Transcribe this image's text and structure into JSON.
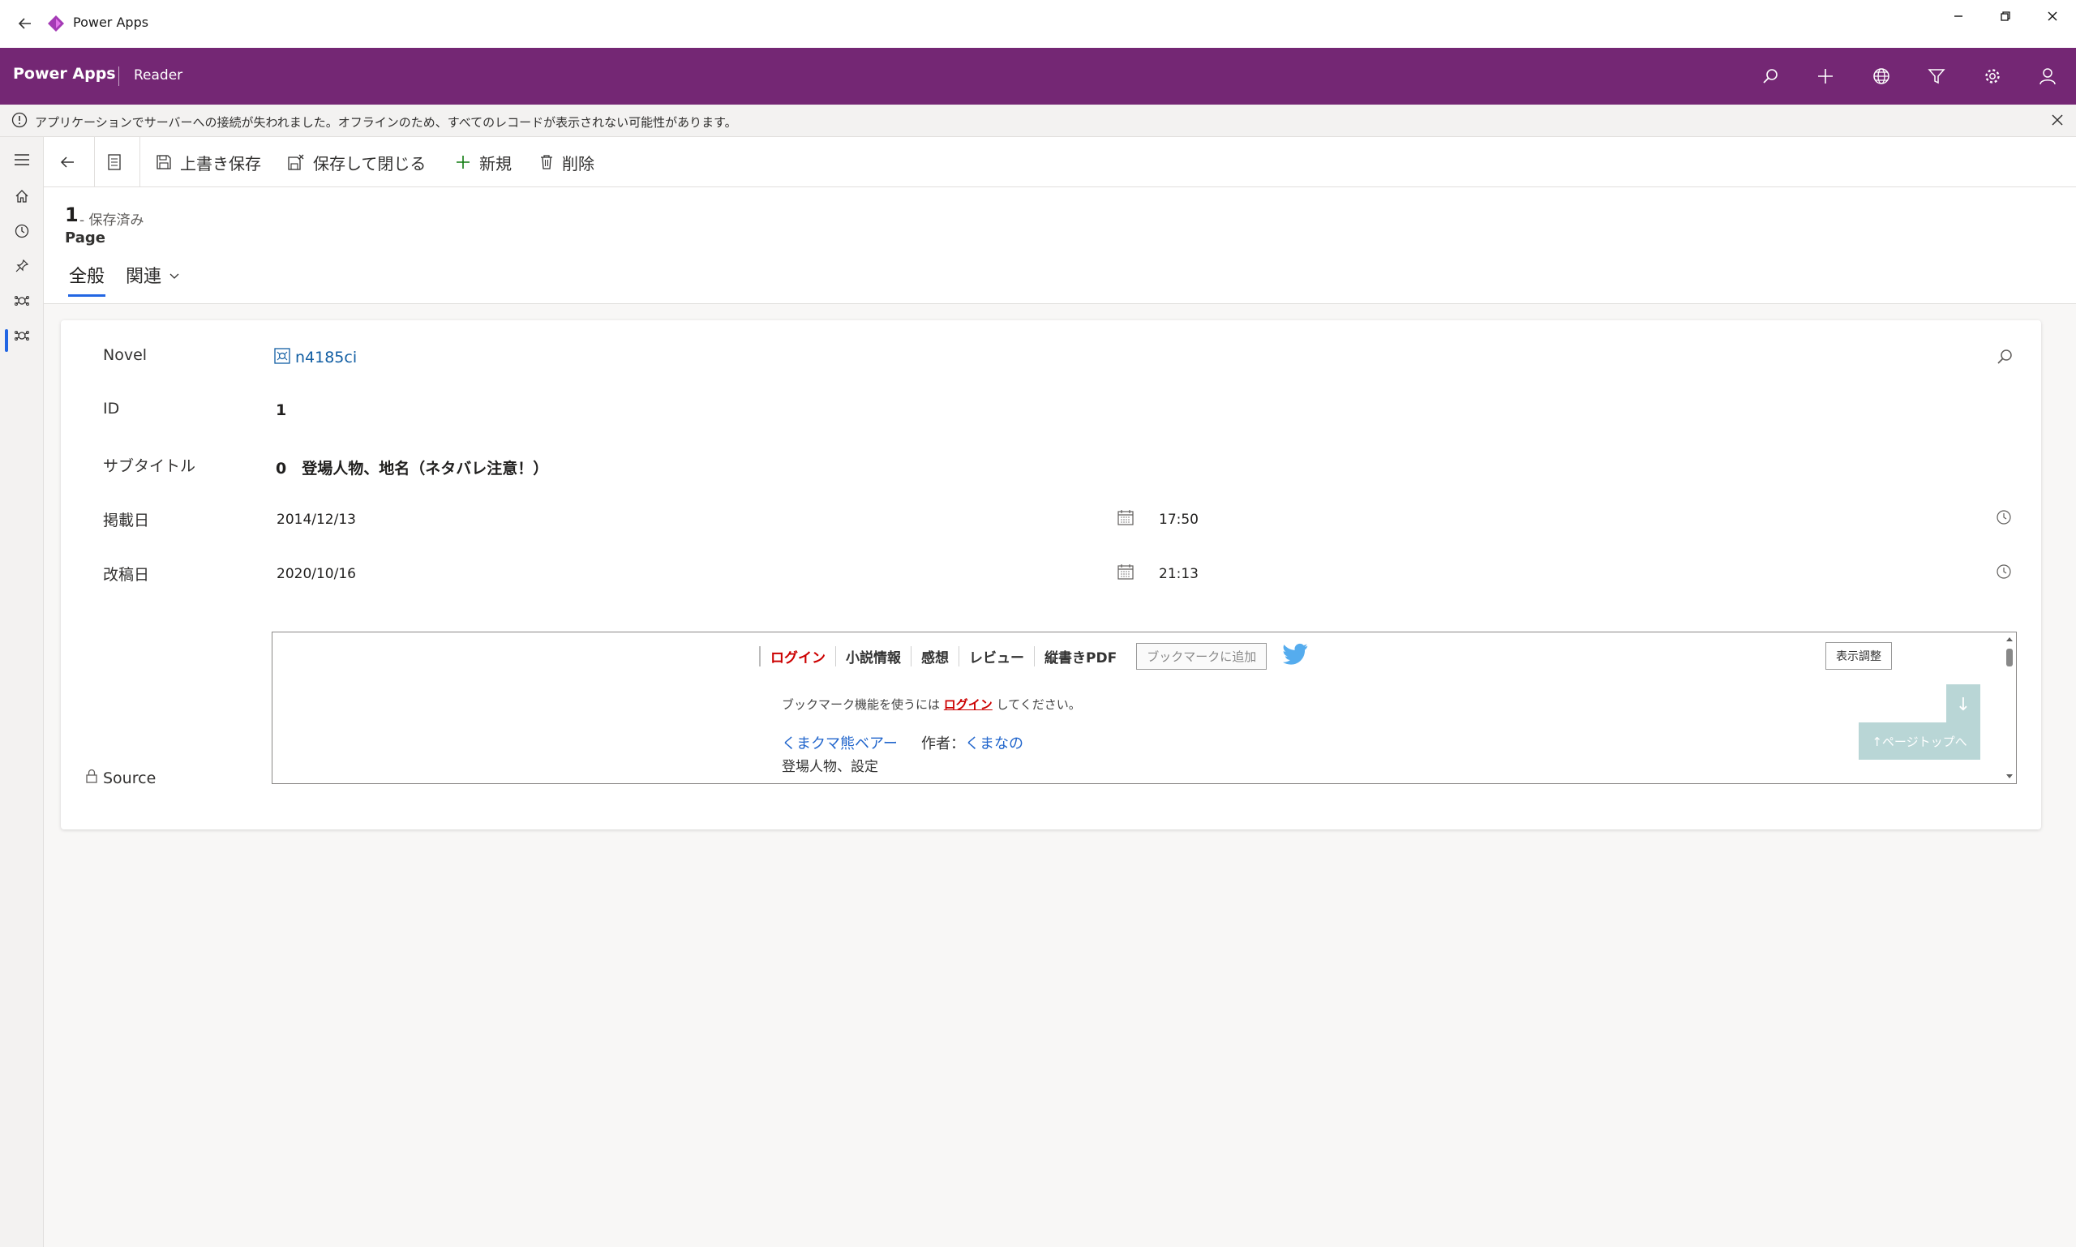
{
  "window": {
    "title": "Power Apps",
    "controls": [
      "minimize-icon",
      "restore-icon",
      "close-icon"
    ]
  },
  "appbar": {
    "app_name": "Power Apps",
    "module_name": "Reader",
    "icons": [
      "search-icon",
      "add-icon",
      "globe-icon",
      "filter-icon",
      "settings-icon",
      "user-icon"
    ],
    "color": "#742774"
  },
  "notification": {
    "message": "アプリケーションでサーバーへの接続が失われました。オフラインのため、すべてのレコードが表示されない可能性があります。"
  },
  "leftnav": {
    "items": [
      "menu-icon",
      "home-icon",
      "recent-icon",
      "pinned-icon",
      "entity-icon",
      "entity-icon-active"
    ]
  },
  "commandbar": {
    "save": "上書き保存",
    "save_close": "保存して閉じる",
    "new": "新規",
    "delete": "削除"
  },
  "record": {
    "id": "1",
    "status": "- 保存済み",
    "entity": "Page",
    "tabs": [
      "全般",
      "関連"
    ]
  },
  "form": {
    "novel_label": "Novel",
    "novel_value": "n4185ci",
    "id_label": "ID",
    "id_value": "1",
    "subtitle_label": "サブタイトル",
    "subtitle_value": "0　登場人物、地名（ネタバレ注意！）",
    "published_label": "掲載日",
    "published_date": "2014/12/13",
    "published_time": "17:50",
    "revised_label": "改稿日",
    "revised_date": "2020/10/16",
    "revised_time": "21:13",
    "source_label": "Source"
  },
  "webpage": {
    "nav": [
      "ログイン",
      "小説情報",
      "感想",
      "レビュー",
      "縦書きPDF"
    ],
    "bookmark_button": "ブックマークに追加",
    "display_button": "表示調整",
    "bookmark_prefix": "ブックマーク機能を使うには",
    "bookmark_link": "ログイン",
    "bookmark_suffix": "してください。",
    "novel_title": "くまクマ熊ベアー",
    "author_prefix": "作者：",
    "author_name": "くまなの",
    "chapter": "登場人物、設定",
    "down_button": "↓",
    "top_button": "↑ページトップへ"
  }
}
